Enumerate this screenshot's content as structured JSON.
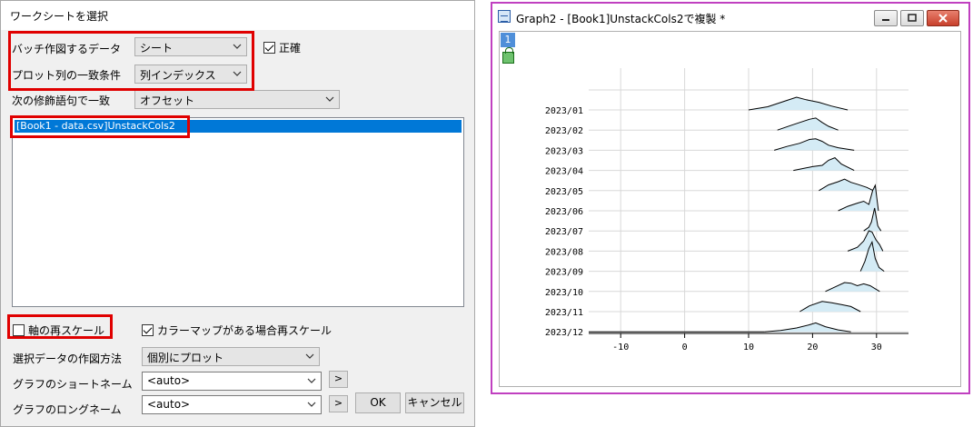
{
  "dialog": {
    "title": "ワークシートを選択",
    "batch_label": "バッチ作図するデータ",
    "batch_value": "シート",
    "match_label": "プロット列の一致条件",
    "match_value": "列インデックス",
    "exact_label": "正確",
    "next_modifier_label": "次の修飾語句で一致",
    "next_modifier_value": "オフセット",
    "list_items": [
      "[Book1 - data.csv]UnstackCols2"
    ],
    "rescale_label": "軸の再スケール",
    "colormap_rescale_label": "カラーマップがある場合再スケール",
    "plot_method_label": "選択データの作図方法",
    "plot_method_value": "個別にプロット",
    "short_name_label": "グラフのショートネーム",
    "short_name_value": "<auto>",
    "long_name_label": "グラフのロングネーム",
    "long_name_value": "<auto>",
    "arrow_label": ">",
    "ok_label": "OK",
    "cancel_label": "キャンセル"
  },
  "graph": {
    "title": "Graph2 - [Book1]UnstackCols2で複製 *",
    "layer_label": "1",
    "fill_color": "#d4ebf5",
    "line_color": "#000000"
  },
  "chart_data": {
    "type": "area",
    "title": "",
    "xlabel": "",
    "ylabel": "",
    "xlim": [
      -15,
      35
    ],
    "x_ticks": [
      -10,
      0,
      10,
      20,
      30
    ],
    "x_tick_labels": [
      "-10",
      "0",
      "10",
      "20",
      "30"
    ],
    "categories": [
      "2023/01",
      "2023/02",
      "2023/03",
      "2023/04",
      "2023/05",
      "2023/06",
      "2023/07",
      "2023/08",
      "2023/09",
      "2023/10",
      "2023/11",
      "2023/12"
    ],
    "grid": true,
    "series": [
      {
        "name": "2023/01",
        "x": [
          10,
          13,
          16,
          17.5,
          19,
          21,
          23,
          25.5
        ],
        "height": [
          0,
          0.25,
          0.75,
          1.0,
          0.8,
          0.6,
          0.3,
          0
        ]
      },
      {
        "name": "2023/02",
        "x": [
          14.5,
          16.5,
          18,
          19.5,
          20.5,
          21.5,
          22.5,
          24
        ],
        "height": [
          0,
          0.35,
          0.6,
          0.85,
          0.95,
          0.6,
          0.3,
          0
        ]
      },
      {
        "name": "2023/03",
        "x": [
          14,
          16,
          18,
          19.5,
          20.5,
          21.5,
          22.5,
          24,
          26.5
        ],
        "height": [
          0,
          0.3,
          0.55,
          0.85,
          0.9,
          0.7,
          0.4,
          0.2,
          0
        ]
      },
      {
        "name": "2023/04",
        "x": [
          17,
          18.5,
          20,
          21.5,
          22.5,
          23.5,
          24.5,
          26.5
        ],
        "height": [
          0,
          0.15,
          0.3,
          0.4,
          0.8,
          1.0,
          0.5,
          0
        ]
      },
      {
        "name": "2023/05",
        "x": [
          21,
          22.5,
          24,
          25,
          26,
          27,
          28.5,
          29.5
        ],
        "height": [
          0,
          0.45,
          0.7,
          0.9,
          0.65,
          0.5,
          0.25,
          0
        ]
      },
      {
        "name": "2023/06",
        "x": [
          24,
          25.5,
          27,
          28,
          28.8,
          29.4,
          29.8,
          30.3
        ],
        "height": [
          0,
          0.35,
          0.6,
          0.75,
          0.5,
          1.6,
          2.0,
          0
        ]
      },
      {
        "name": "2023/07",
        "x": [
          28,
          28.8,
          29.2,
          29.7,
          30.2,
          30.7
        ],
        "height": [
          0,
          0.3,
          0.7,
          1.8,
          0.4,
          0
        ]
      },
      {
        "name": "2023/08",
        "x": [
          25.5,
          27,
          28,
          28.8,
          29.3,
          29.9,
          30.5,
          31
        ],
        "height": [
          0,
          0.3,
          0.8,
          1.6,
          1.5,
          0.9,
          0.5,
          0
        ]
      },
      {
        "name": "2023/09",
        "x": [
          27.5,
          28.2,
          28.8,
          29.3,
          29.8,
          30.4,
          31.2
        ],
        "height": [
          0,
          0.8,
          1.8,
          2.3,
          1.0,
          0.3,
          0
        ]
      },
      {
        "name": "2023/10",
        "x": [
          22,
          23.5,
          25,
          26,
          27,
          28,
          29,
          30.5
        ],
        "height": [
          0,
          0.35,
          0.7,
          0.65,
          0.45,
          0.6,
          0.45,
          0
        ]
      },
      {
        "name": "2023/11",
        "x": [
          18,
          19.5,
          21.5,
          23,
          24.5,
          26,
          27.5
        ],
        "height": [
          0,
          0.45,
          0.8,
          0.7,
          0.55,
          0.4,
          0
        ]
      },
      {
        "name": "2023/12",
        "x": [
          12.5,
          15,
          17.5,
          19.5,
          20.5,
          22,
          24,
          26
        ],
        "height": [
          0,
          0.1,
          0.3,
          0.55,
          0.7,
          0.4,
          0.15,
          0
        ]
      }
    ]
  }
}
